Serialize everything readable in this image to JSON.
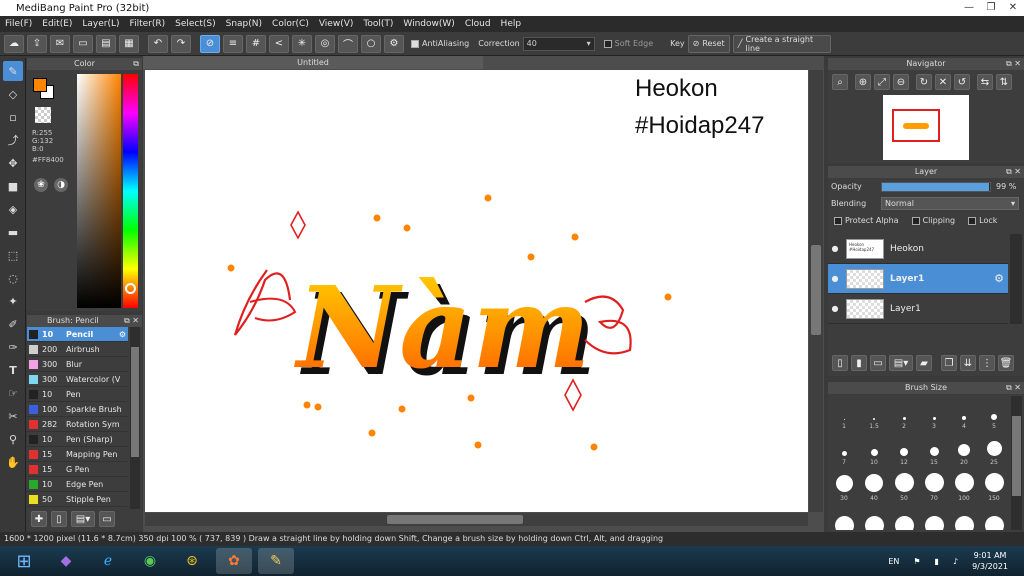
{
  "window": {
    "title": "MediBang Paint Pro (32bit)"
  },
  "menu": [
    "File(F)",
    "Edit(E)",
    "Layer(L)",
    "Filter(R)",
    "Select(S)",
    "Snap(N)",
    "Color(C)",
    "View(V)",
    "Tool(T)",
    "Window(W)",
    "Cloud",
    "Help"
  ],
  "toolbar": {
    "antialiasing_label": "AntiAliasing",
    "correction_label": "Correction",
    "correction_value": "40",
    "soft_edge_label": "Soft Edge",
    "key_label": "Key",
    "reset_label": "Reset",
    "straight_line_label": "Create a straight line"
  },
  "color": {
    "panel_title": "Color",
    "r": "R:255",
    "g": "G:132",
    "b": "B:0",
    "hex": "#FF8400",
    "foreground": "#FF8400"
  },
  "brush_panel": {
    "title": "Brush: Pencil",
    "items": [
      {
        "size": "10",
        "name": "Pencil",
        "color": "#222222"
      },
      {
        "size": "200",
        "name": "Airbrush",
        "color": "#cfcfcf"
      },
      {
        "size": "300",
        "name": "Blur",
        "color": "#f2a0e8"
      },
      {
        "size": "300",
        "name": "Watercolor (V",
        "color": "#7fd6f0"
      },
      {
        "size": "10",
        "name": "Pen",
        "color": "#222222"
      },
      {
        "size": "100",
        "name": "Sparkle Brush",
        "color": "#3a5fe0"
      },
      {
        "size": "282",
        "name": "Rotation Sym",
        "color": "#e03030"
      },
      {
        "size": "10",
        "name": "Pen (Sharp)",
        "color": "#222222"
      },
      {
        "size": "15",
        "name": "Mapping Pen",
        "color": "#e03030"
      },
      {
        "size": "15",
        "name": "G Pen",
        "color": "#e03030"
      },
      {
        "size": "10",
        "name": "Edge Pen",
        "color": "#2aa82a"
      },
      {
        "size": "50",
        "name": "Stipple Pen",
        "color": "#e8e020"
      }
    ]
  },
  "document": {
    "tab_title": "Untitled"
  },
  "canvas": {
    "watermark_line1": "Heokon",
    "watermark_line2": "#Hoidap247",
    "artwork_text": "Nàm"
  },
  "navigator": {
    "title": "Navigator"
  },
  "layer_panel": {
    "title": "Layer",
    "opacity_label": "Opacity",
    "opacity_value": "99 %",
    "opacity_fraction": 0.99,
    "blending_label": "Blending",
    "blending_value": "Normal",
    "protect_alpha_label": "Protect Alpha",
    "clipping_label": "Clipping",
    "lock_label": "Lock",
    "layers": [
      {
        "name": "Heokon",
        "thumb": "Heokon #Hoidap247",
        "selected": false
      },
      {
        "name": "Layer1",
        "thumb": "",
        "selected": true
      },
      {
        "name": "Layer1",
        "thumb": "",
        "selected": false
      }
    ]
  },
  "brush_size": {
    "title": "Brush Size",
    "sizes": [
      "1",
      "1.5",
      "2",
      "3",
      "4",
      "5",
      "7",
      "10",
      "12",
      "15",
      "20",
      "25",
      "30",
      "40",
      "50",
      "70",
      "100",
      "150",
      "",
      "",
      "",
      "",
      "",
      ""
    ]
  },
  "status": {
    "text": "1600 * 1200 pixel   (11.6 * 8.7cm)   350 dpi   100 %   ( 737, 839 )   Draw a straight line by holding down Shift, Change a brush size by holding down Ctrl, Alt, and dragging"
  },
  "taskbar": {
    "lang": "EN",
    "time": "9:01 AM",
    "date": "9/3/2021"
  }
}
